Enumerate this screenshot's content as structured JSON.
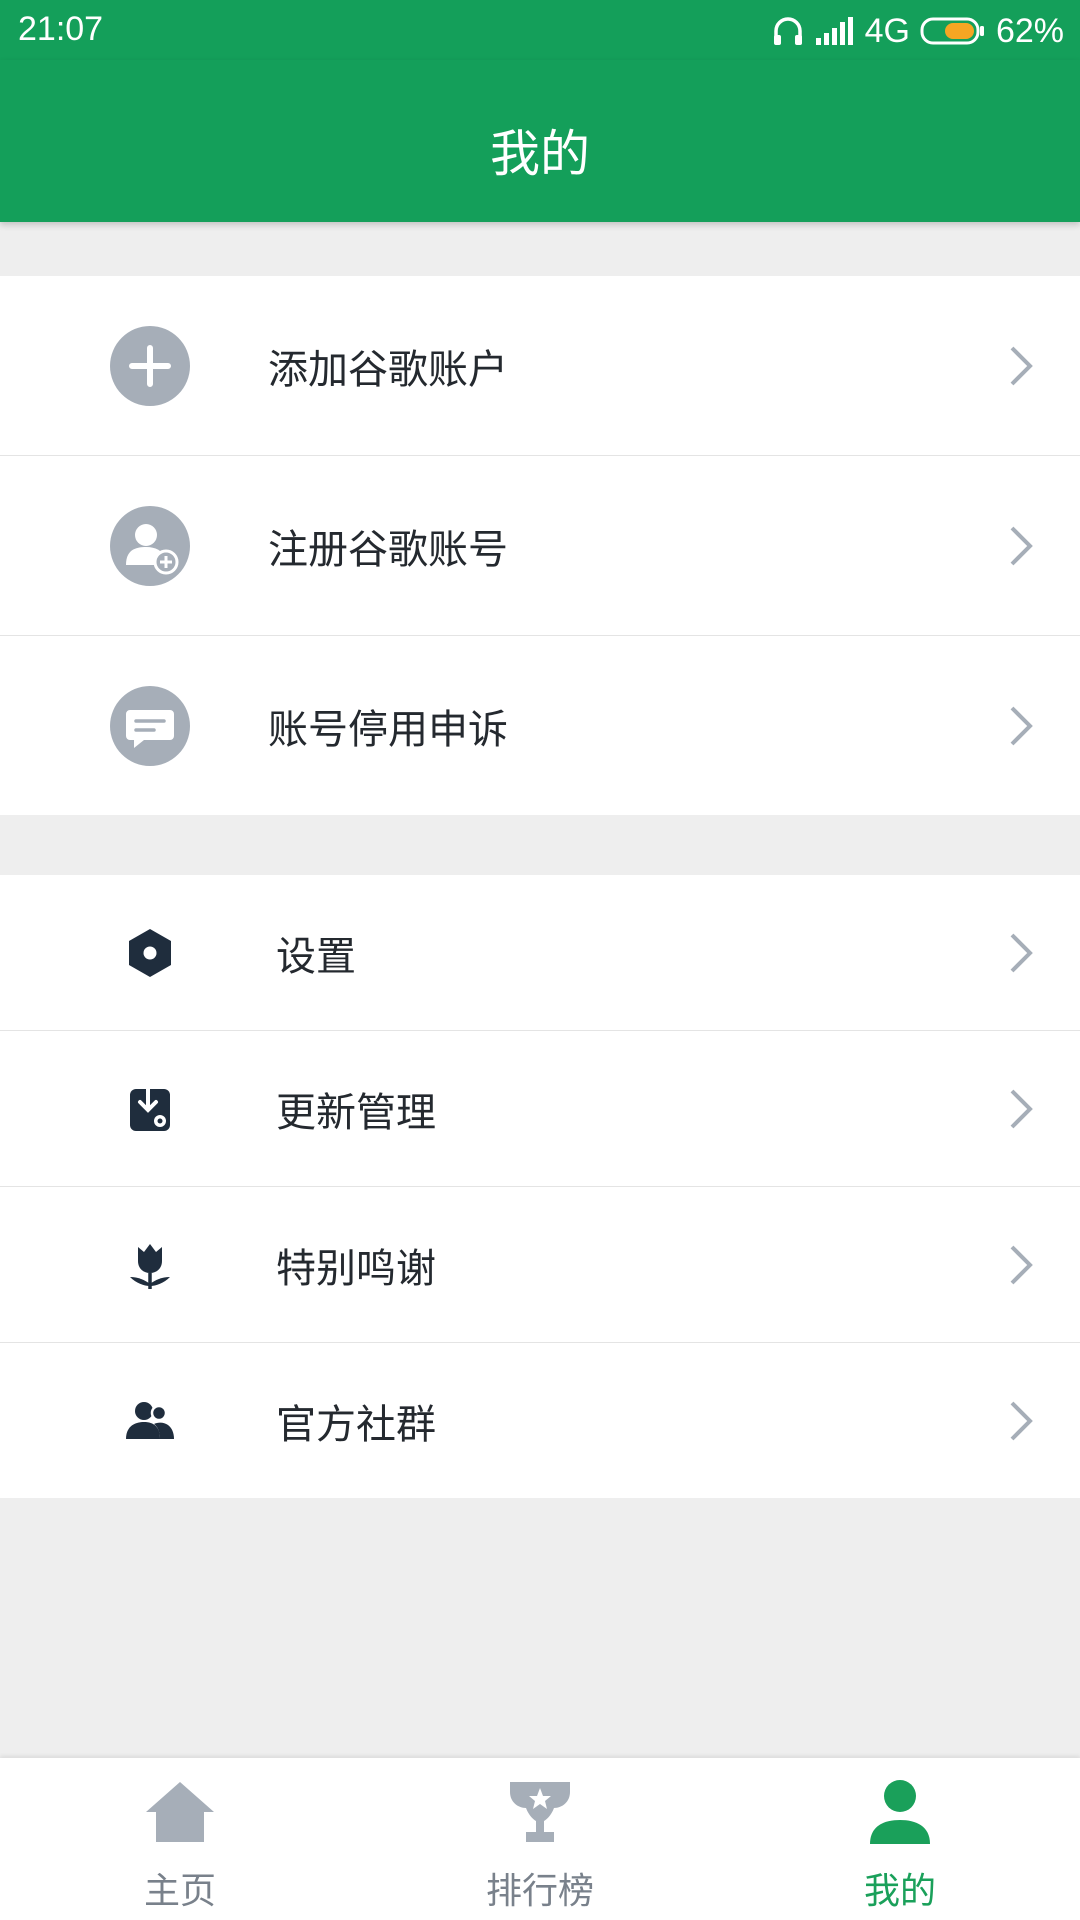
{
  "status_bar": {
    "time": "21:07",
    "network": "4G",
    "battery": "62%"
  },
  "app_bar": {
    "title": "我的"
  },
  "account_group": {
    "items": [
      {
        "label": "添加谷歌账户",
        "icon": "add-icon"
      },
      {
        "label": "注册谷歌账号",
        "icon": "user-add-icon"
      },
      {
        "label": "账号停用申诉",
        "icon": "chat-icon"
      }
    ]
  },
  "settings_group": {
    "items": [
      {
        "label": "设置",
        "icon": "settings-hexagon-icon"
      },
      {
        "label": "更新管理",
        "icon": "update-download-icon"
      },
      {
        "label": "特别鸣谢",
        "icon": "tulip-icon"
      },
      {
        "label": "官方社群",
        "icon": "group-people-icon"
      }
    ]
  },
  "tab_bar": {
    "tabs": [
      {
        "label": "主页",
        "icon": "home-icon",
        "active": false
      },
      {
        "label": "排行榜",
        "icon": "trophy-icon",
        "active": false
      },
      {
        "label": "我的",
        "icon": "person-icon",
        "active": true
      }
    ]
  },
  "colors": {
    "primary": "#149f5a",
    "active_tab": "#1aa05a",
    "inactive_icon": "#a6aeb8",
    "dark_icon": "#1f2d3d",
    "background": "#eeeeee"
  }
}
